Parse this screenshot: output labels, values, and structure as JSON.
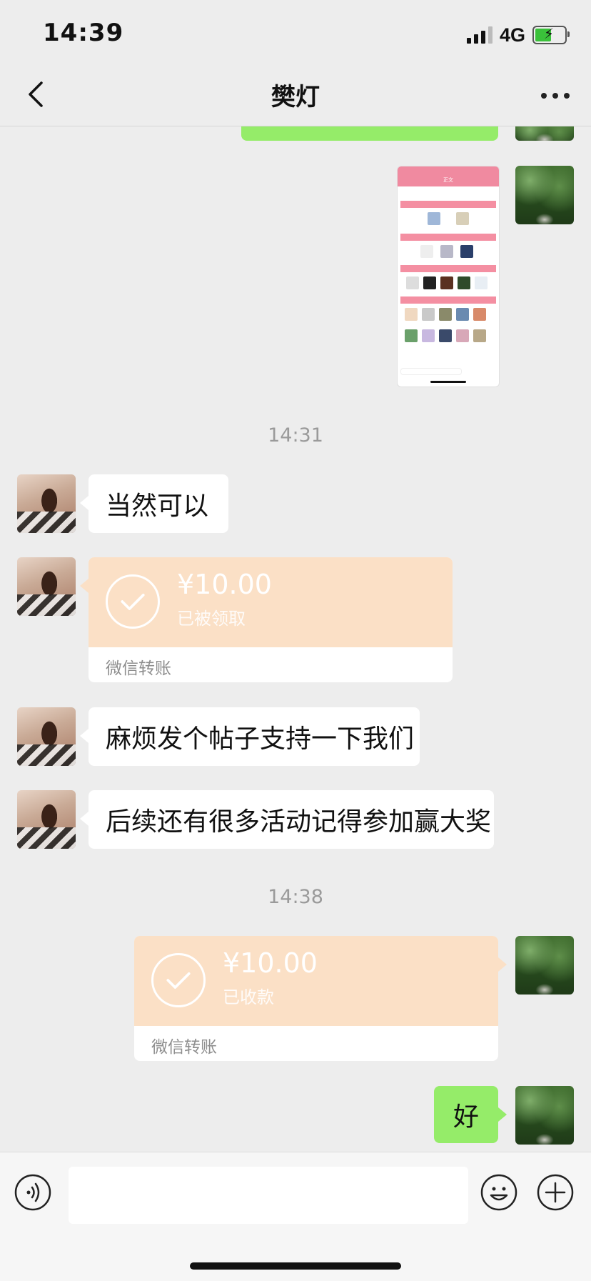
{
  "status_bar": {
    "time": "14:39",
    "network": "4G"
  },
  "nav": {
    "title": "樊灯"
  },
  "screenshot_thumb": {
    "title": "正文"
  },
  "timestamps": [
    "14:31",
    "14:38"
  ],
  "messages": {
    "m1": "当然可以",
    "m2": "麻烦发个帖子支持一下我们",
    "m3": "后续还有很多活动记得参加赢大奖",
    "m4": "好"
  },
  "transfers": [
    {
      "amount": "¥10.00",
      "status": "已被领取",
      "label": "微信转账"
    },
    {
      "amount": "¥10.00",
      "status": "已收款",
      "label": "微信转账"
    }
  ],
  "colors": {
    "green_bubble": "#95ec69",
    "transfer_bg": "#fbe0c6",
    "chat_bg": "#ededed"
  },
  "icons": [
    "back-icon",
    "more-icon",
    "voice-icon",
    "emoji-icon",
    "plus-icon",
    "check-icon"
  ]
}
